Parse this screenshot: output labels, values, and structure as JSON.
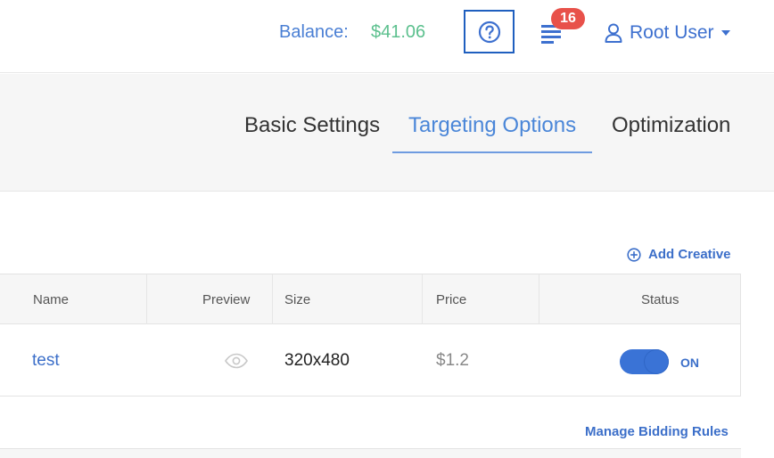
{
  "header": {
    "balance_label": "Balance:",
    "balance_value": "$41.06",
    "help_icon": "question-circle-icon",
    "notifications_icon": "list-lines-icon",
    "notifications_count": "16",
    "user_icon": "user-outline-icon",
    "user_name": "Root User"
  },
  "tabs": [
    {
      "label": "Basic Settings",
      "active": false
    },
    {
      "label": "Targeting Options",
      "active": true
    },
    {
      "label": "Optimization",
      "active": false
    }
  ],
  "creatives": {
    "add_label": "Add Creative",
    "add_icon": "plus-circle-icon",
    "columns": [
      "Name",
      "Preview",
      "Size",
      "Price",
      "Status"
    ],
    "rows": [
      {
        "name": "test",
        "preview_icon": "eye-icon",
        "size": "320x480",
        "price": "$1.2",
        "status_on": true,
        "status_label": "ON"
      }
    ]
  },
  "bidding": {
    "manage_label": "Manage Bidding Rules"
  },
  "colors": {
    "accent": "#3c6fc9",
    "balance_value": "#5cc08e",
    "badge": "#e8514a",
    "help_border": "#1f5fbf"
  }
}
